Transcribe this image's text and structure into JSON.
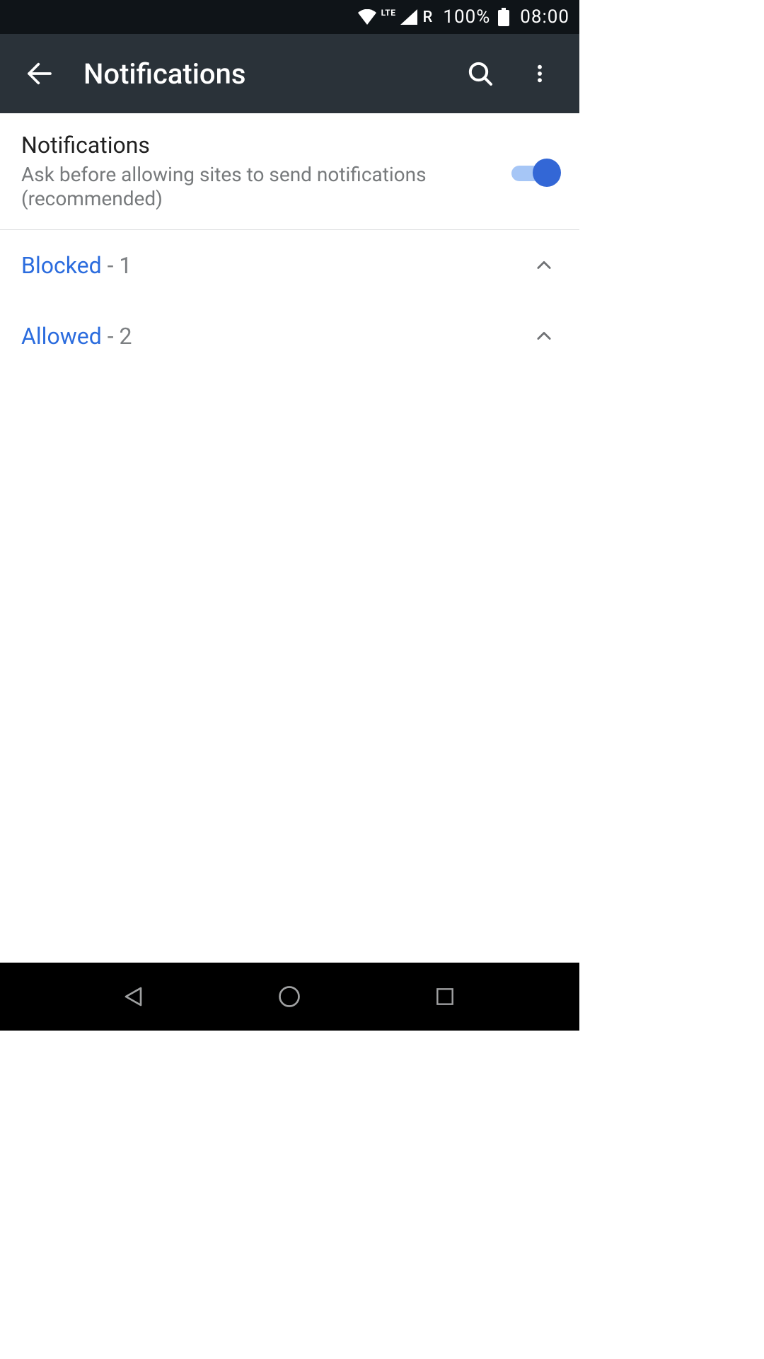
{
  "statusbar": {
    "network_label": "LTE",
    "roaming_label": "R",
    "battery_pct": "100%",
    "time": "08:00"
  },
  "appbar": {
    "title": "Notifications"
  },
  "main": {
    "toggle": {
      "title": "Notifications",
      "subtitle": "Ask before allowing sites to send notifications (recommended)",
      "on": true
    },
    "sections": [
      {
        "label": "Blocked",
        "sep": " - ",
        "count": "1"
      },
      {
        "label": "Allowed",
        "sep": " - ",
        "count": "2"
      }
    ]
  },
  "colors": {
    "accent": "#3367d6",
    "header_bg": "#2a3239"
  }
}
